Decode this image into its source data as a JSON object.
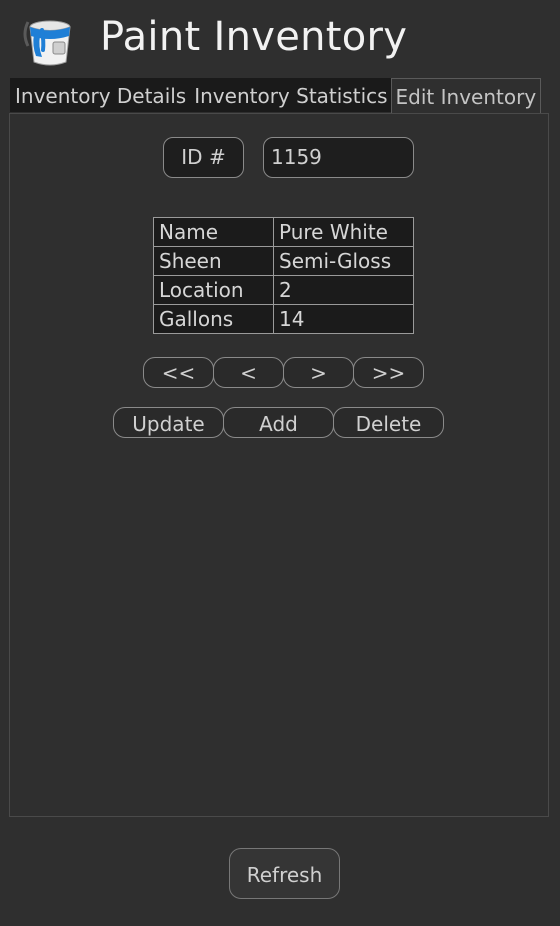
{
  "app": {
    "title": "Paint Inventory",
    "logo_icon": "paint-bucket-icon"
  },
  "tabs": [
    {
      "label": "Inventory Details",
      "active": false
    },
    {
      "label": "Inventory Statistics",
      "active": false
    },
    {
      "label": "Edit Inventory",
      "active": true
    }
  ],
  "record": {
    "id_label": "ID #",
    "id_value": "1159",
    "fields": [
      {
        "key": "Name",
        "value": "Pure White"
      },
      {
        "key": "Sheen",
        "value": "Semi-Gloss"
      },
      {
        "key": "Location",
        "value": "2"
      },
      {
        "key": "Gallons",
        "value": "14"
      }
    ]
  },
  "navigation": {
    "first": "<<",
    "prev": "<",
    "next": ">",
    "last": ">>"
  },
  "actions": {
    "update": "Update",
    "add": "Add",
    "delete": "Delete"
  },
  "footer": {
    "refresh": "Refresh"
  },
  "colors": {
    "background": "#2f2f2f",
    "field_background": "#1b1b1b",
    "bucket_blue": "#1f7fd6"
  }
}
